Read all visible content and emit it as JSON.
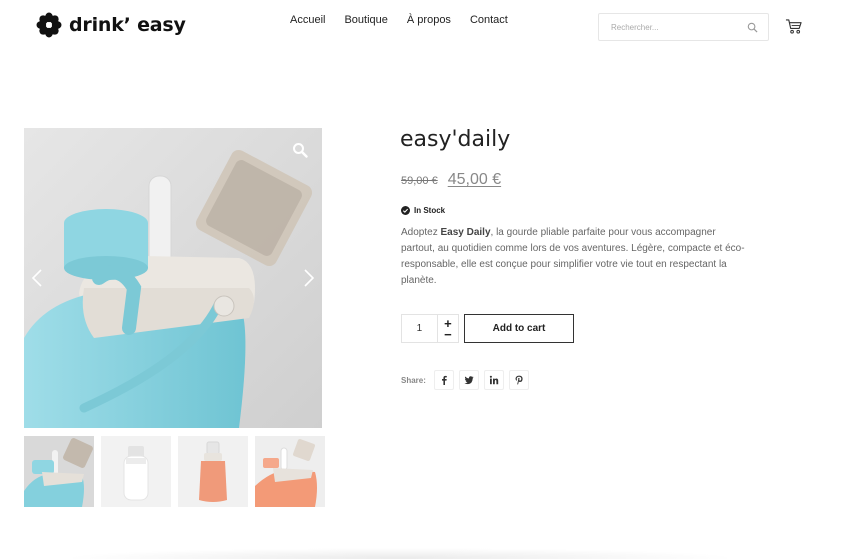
{
  "header": {
    "logo_text": "drink’ easy",
    "nav": [
      "Accueil",
      "Boutique",
      "À propos",
      "Contact"
    ],
    "search": {
      "placeholder": "Rechercher..."
    },
    "icons": {
      "search": "search-icon",
      "cart": "cart-icon"
    }
  },
  "gallery": {
    "icons": {
      "zoom": "zoom-icon",
      "prev": "chevron-left-icon",
      "next": "chevron-right-icon"
    },
    "thumbnail_count": 4
  },
  "product": {
    "title": "easy'daily",
    "old_price": "59,00 €",
    "new_price": "45,00 €",
    "stock": "In Stock",
    "desc_intro": "Adoptez ",
    "desc_bold": "Easy Daily",
    "desc_rest": ", la gourde pliable parfaite pour vous accompagner partout, au quotidien comme lors de vos aventures. Légère, compacte et éco-responsable, elle est conçue pour simplifier votre vie tout en respectant la planète.",
    "quantity": "1",
    "qty_plus": "+",
    "qty_minus": "−",
    "add_to_cart": "Add to cart",
    "share_label": "Share:",
    "share_icons": [
      "facebook-icon",
      "twitter-icon",
      "linkedin-icon",
      "pinterest-icon"
    ]
  },
  "colors": {
    "accent": "#222222",
    "bottle_blue": "#8fd6e2",
    "bottle_orange": "#f09a7a"
  }
}
